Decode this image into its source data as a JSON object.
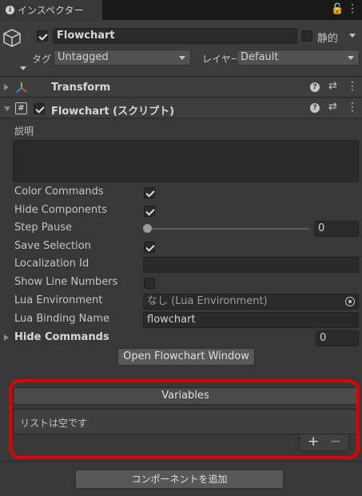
{
  "tab": {
    "title": "インスペクター",
    "info_glyph": "i",
    "lock_glyph": "🔓",
    "menu_glyph": "⋮"
  },
  "header": {
    "object_name": "Flowchart",
    "active": true,
    "static_label": "静的",
    "static": false,
    "tag_label": "タグ",
    "tag_value": "Untagged",
    "layer_label": "レイヤー",
    "layer_value": "Default"
  },
  "components": [
    {
      "title": "Transform",
      "expanded": false,
      "icon": "transform-axes-icon"
    },
    {
      "title": "Flowchart (スクリプト)",
      "expanded": true,
      "enabled": true,
      "icon": "script-hash-icon"
    }
  ],
  "component_glyphs": {
    "help": "?",
    "preset": "⇄",
    "more": "⋮",
    "hash": "#"
  },
  "flowchart": {
    "description_label": "説明",
    "description_value": "",
    "color_commands_label": "Color Commands",
    "color_commands": true,
    "hide_components_label": "Hide Components",
    "hide_components": true,
    "step_pause_label": "Step Pause",
    "step_pause_value": "0",
    "save_selection_label": "Save Selection",
    "save_selection": true,
    "localization_id_label": "Localization Id",
    "localization_id_value": "",
    "show_line_numbers_label": "Show Line Numbers",
    "show_line_numbers": false,
    "lua_environment_label": "Lua Environment",
    "lua_environment_value": "なし (Lua Environment)",
    "lua_binding_name_label": "Lua Binding Name",
    "lua_binding_name_value": "flowchart",
    "hide_commands_label": "Hide Commands",
    "hide_commands_value": "0",
    "open_window_button": "Open Flowchart Window"
  },
  "variables": {
    "header": "Variables",
    "empty_text": "リストは空です",
    "add_glyph": "+",
    "remove_glyph": "−"
  },
  "add_component_button": "コンポーネントを追加",
  "colors": {
    "highlight": "#e20000",
    "panel": "#383838"
  }
}
